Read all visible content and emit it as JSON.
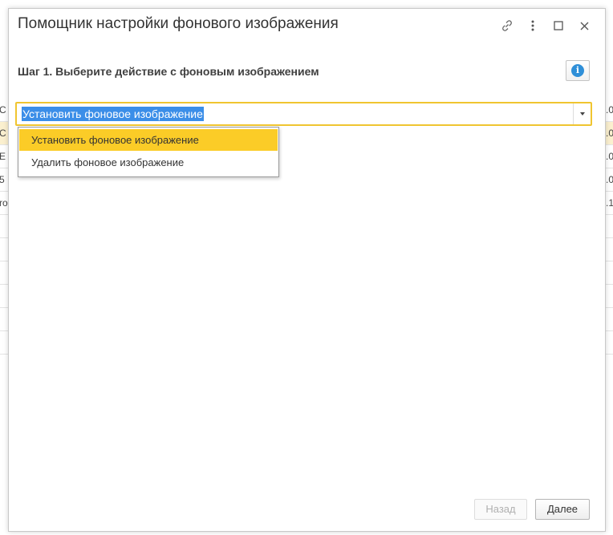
{
  "background": {
    "left_rows": [
      "С",
      "С",
      "Е",
      "5",
      "ro"
    ],
    "right_rows": [
      ".0",
      ".0",
      ".0",
      ".0",
      ".1"
    ]
  },
  "dialog": {
    "title": "Помощник настройки фонового изображения",
    "icons": [
      "link-icon",
      "more-icon",
      "maximize-icon",
      "close-icon"
    ],
    "step_heading": "Шаг 1. Выберите действие с фоновым изображением",
    "info_icon_glyph": "i",
    "combo": {
      "value": "Установить фоновое изображение"
    },
    "dropdown": {
      "options": [
        "Установить фоновое изображение",
        "Удалить фоновое изображение"
      ],
      "selected_index": 0
    },
    "buttons": {
      "back_label": "Назад",
      "back_disabled": true,
      "next_label": "Далее"
    }
  },
  "colors": {
    "accent_yellow": "#fbcc27",
    "focus_border": "#f0c530",
    "selection_blue": "#3b8ee8",
    "info_blue": "#2f8fd8"
  }
}
